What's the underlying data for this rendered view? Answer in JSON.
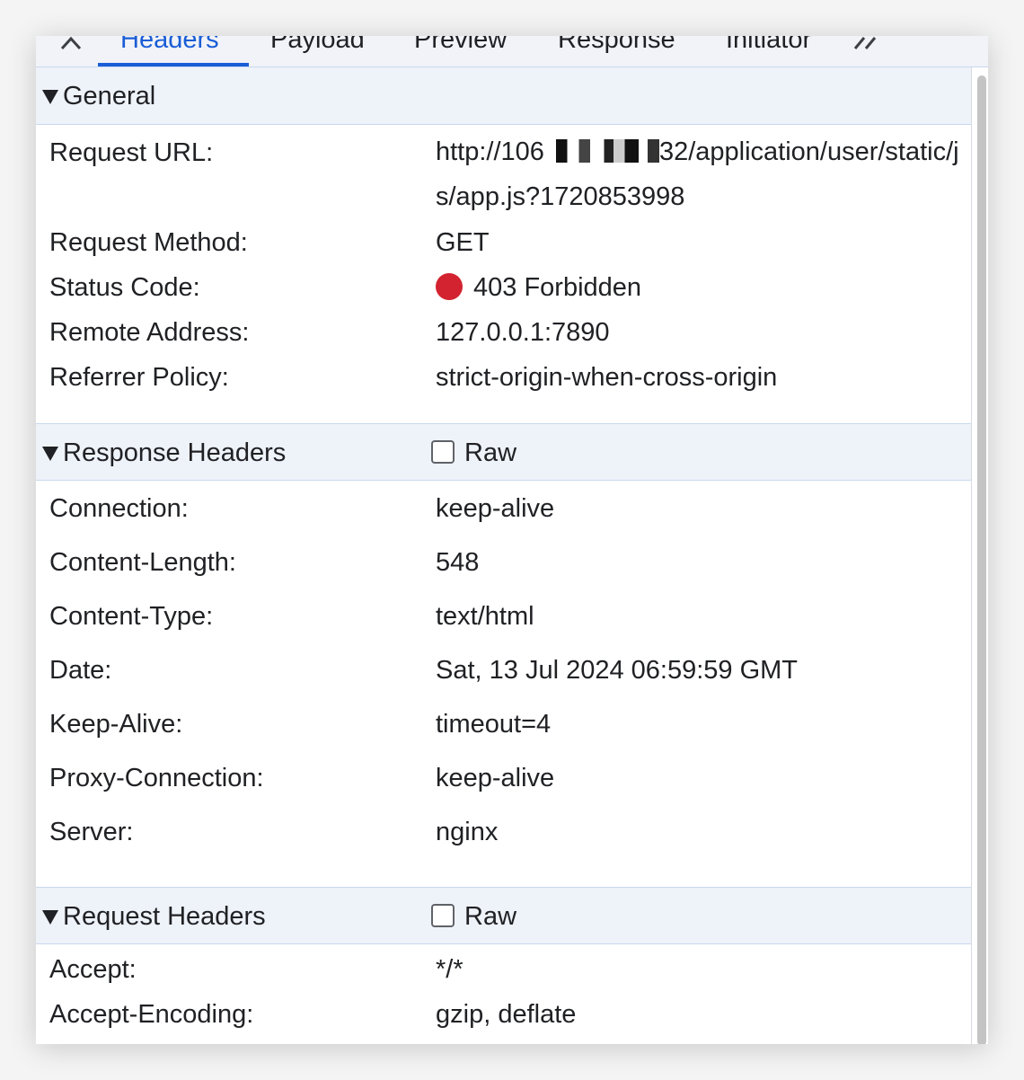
{
  "tabs": [
    {
      "label": "Headers",
      "active": true
    },
    {
      "label": "Payload",
      "active": false
    },
    {
      "label": "Preview",
      "active": false
    },
    {
      "label": "Response",
      "active": false
    },
    {
      "label": "Initiator",
      "active": false
    }
  ],
  "general": {
    "title": "General",
    "request_url_label": "Request URL:",
    "request_url_prefix": "http://106",
    "request_url_suffix": "32/application/user/static/js/app.js?1720853998",
    "request_method_label": "Request Method:",
    "request_method": "GET",
    "status_code_label": "Status Code:",
    "status_code": "403 Forbidden",
    "status_color": "#d32330",
    "remote_address_label": "Remote Address:",
    "remote_address": "127.0.0.1:7890",
    "referrer_policy_label": "Referrer Policy:",
    "referrer_policy": "strict-origin-when-cross-origin"
  },
  "response_headers": {
    "title": "Response Headers",
    "raw_label": "Raw",
    "items": [
      {
        "key": "Connection:",
        "value": "keep-alive"
      },
      {
        "key": "Content-Length:",
        "value": "548"
      },
      {
        "key": "Content-Type:",
        "value": "text/html"
      },
      {
        "key": "Date:",
        "value": "Sat, 13 Jul 2024 06:59:59 GMT"
      },
      {
        "key": "Keep-Alive:",
        "value": "timeout=4"
      },
      {
        "key": "Proxy-Connection:",
        "value": "keep-alive"
      },
      {
        "key": "Server:",
        "value": "nginx"
      }
    ]
  },
  "request_headers": {
    "title": "Request Headers",
    "raw_label": "Raw",
    "items": [
      {
        "key": "Accept:",
        "value": "*/*"
      },
      {
        "key": "Accept-Encoding:",
        "value": "gzip, deflate"
      }
    ]
  },
  "accent_color": "#1a5dd6"
}
